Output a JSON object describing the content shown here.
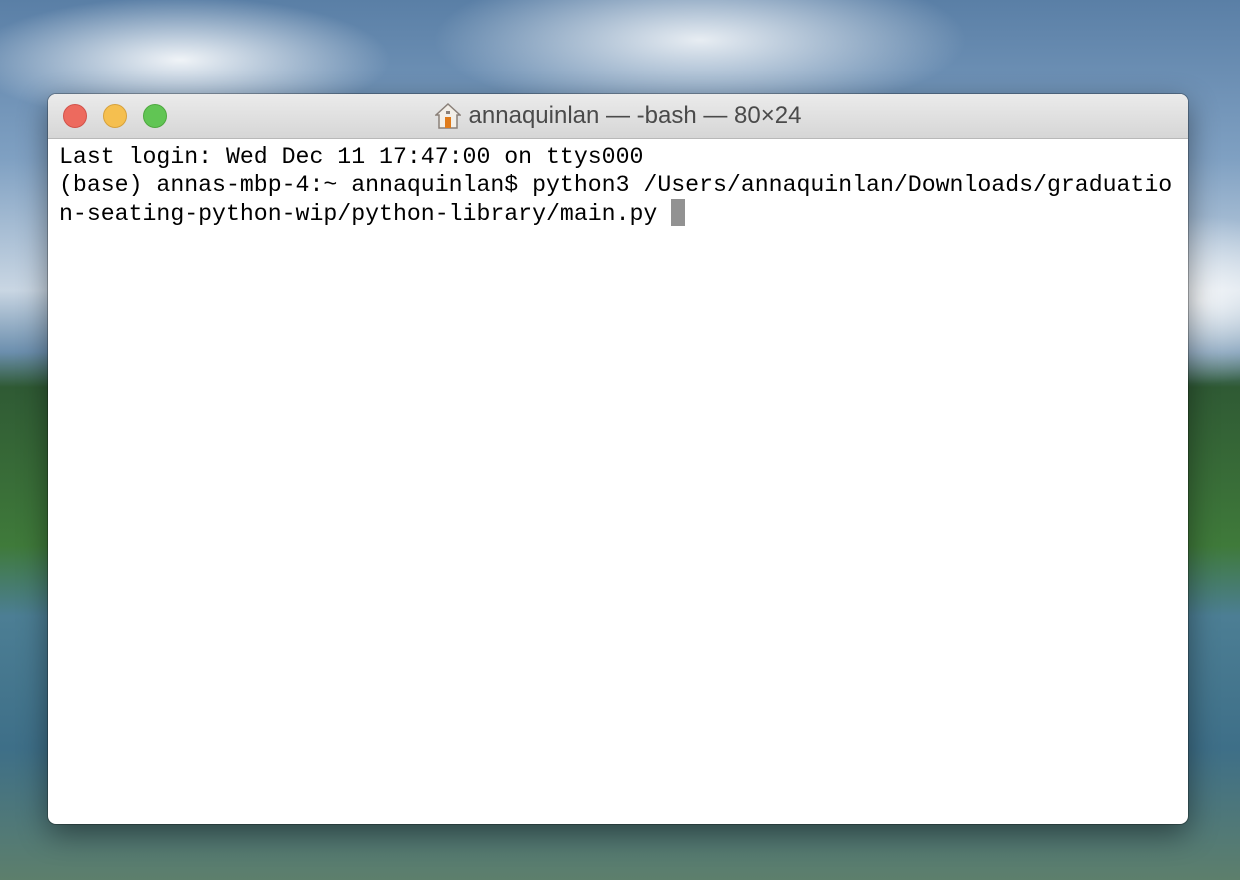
{
  "window": {
    "title": "annaquinlan — -bash — 80×24",
    "title_icon": "home-folder-icon"
  },
  "terminal": {
    "lines": [
      "Last login: Wed Dec 11 17:47:00 on ttys000",
      "(base) annas-mbp-4:~ annaquinlan$ python3 /Users/annaquinlan/Downloads/graduatio",
      "n-seating-python-wip/python-library/main.py "
    ]
  },
  "colors": {
    "close": "#ed6a5e",
    "minimize": "#f5bf4f",
    "zoom": "#61c554",
    "cursor": "#929292"
  }
}
